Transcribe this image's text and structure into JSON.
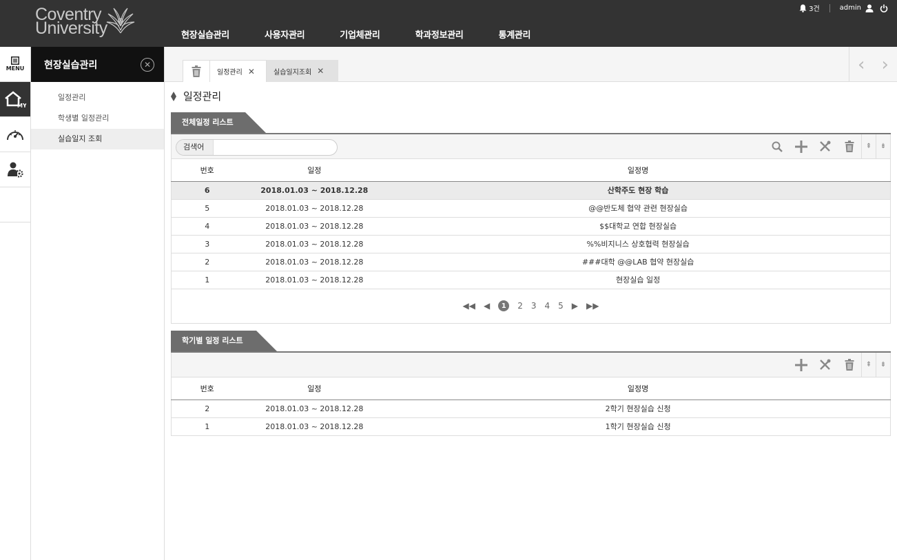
{
  "app": {
    "brand_line1": "Coventry",
    "brand_line2": "University"
  },
  "gnb": [
    "현장실습관리",
    "사용자관리",
    "기업체관리",
    "학과정보관리",
    "통계관리"
  ],
  "util": {
    "notice": "3건",
    "user": "admin"
  },
  "rail": {
    "menu_label": "MENU",
    "items": [
      "home-my-icon",
      "speedometer-icon",
      "user-settings-icon"
    ]
  },
  "sub": {
    "title": "현장실습관리",
    "items": [
      {
        "label": "일정관리"
      },
      {
        "label": "학생별 일정관리"
      },
      {
        "label": "실습일지 조회"
      }
    ]
  },
  "tabs": [
    {
      "label": "일정관리"
    },
    {
      "label": "실습일지조회"
    }
  ],
  "page_title": "일정관리",
  "section1": {
    "title": "전체일정 리스트",
    "search_label": "검색어",
    "search_value": "",
    "columns": [
      "번호",
      "일정",
      "일정명"
    ],
    "rows": [
      {
        "no": "6",
        "date": "2018.01.03 ~ 2018.12.28",
        "name": "산학주도 현장 학습"
      },
      {
        "no": "5",
        "date": "2018.01.03 ~ 2018.12.28",
        "name": "@@반도체 협약 관련 현장실습"
      },
      {
        "no": "4",
        "date": "2018.01.03 ~ 2018.12.28",
        "name": "$$대학교 연합 현장실습"
      },
      {
        "no": "3",
        "date": "2018.01.03 ~ 2018.12.28",
        "name": "%%비지니스 상호협력 현장실습"
      },
      {
        "no": "2",
        "date": "2018.01.03 ~ 2018.12.28",
        "name": "###대학 @@LAB 협약 현장실습"
      },
      {
        "no": "1",
        "date": "2018.01.03 ~ 2018.12.28",
        "name": "현장실습 일정"
      }
    ],
    "pager": {
      "pages": [
        "1",
        "2",
        "3",
        "4",
        "5"
      ]
    }
  },
  "section2": {
    "title": "학기별 일정 리스트",
    "columns": [
      "번호",
      "일정",
      "일정명"
    ],
    "rows": [
      {
        "no": "2",
        "date": "2018.01.03 ~ 2018.12.28",
        "name": "2학기 현장실습 신청"
      },
      {
        "no": "1",
        "date": "2018.01.03 ~ 2018.12.28",
        "name": "1학기 현장실습 신청"
      }
    ]
  }
}
